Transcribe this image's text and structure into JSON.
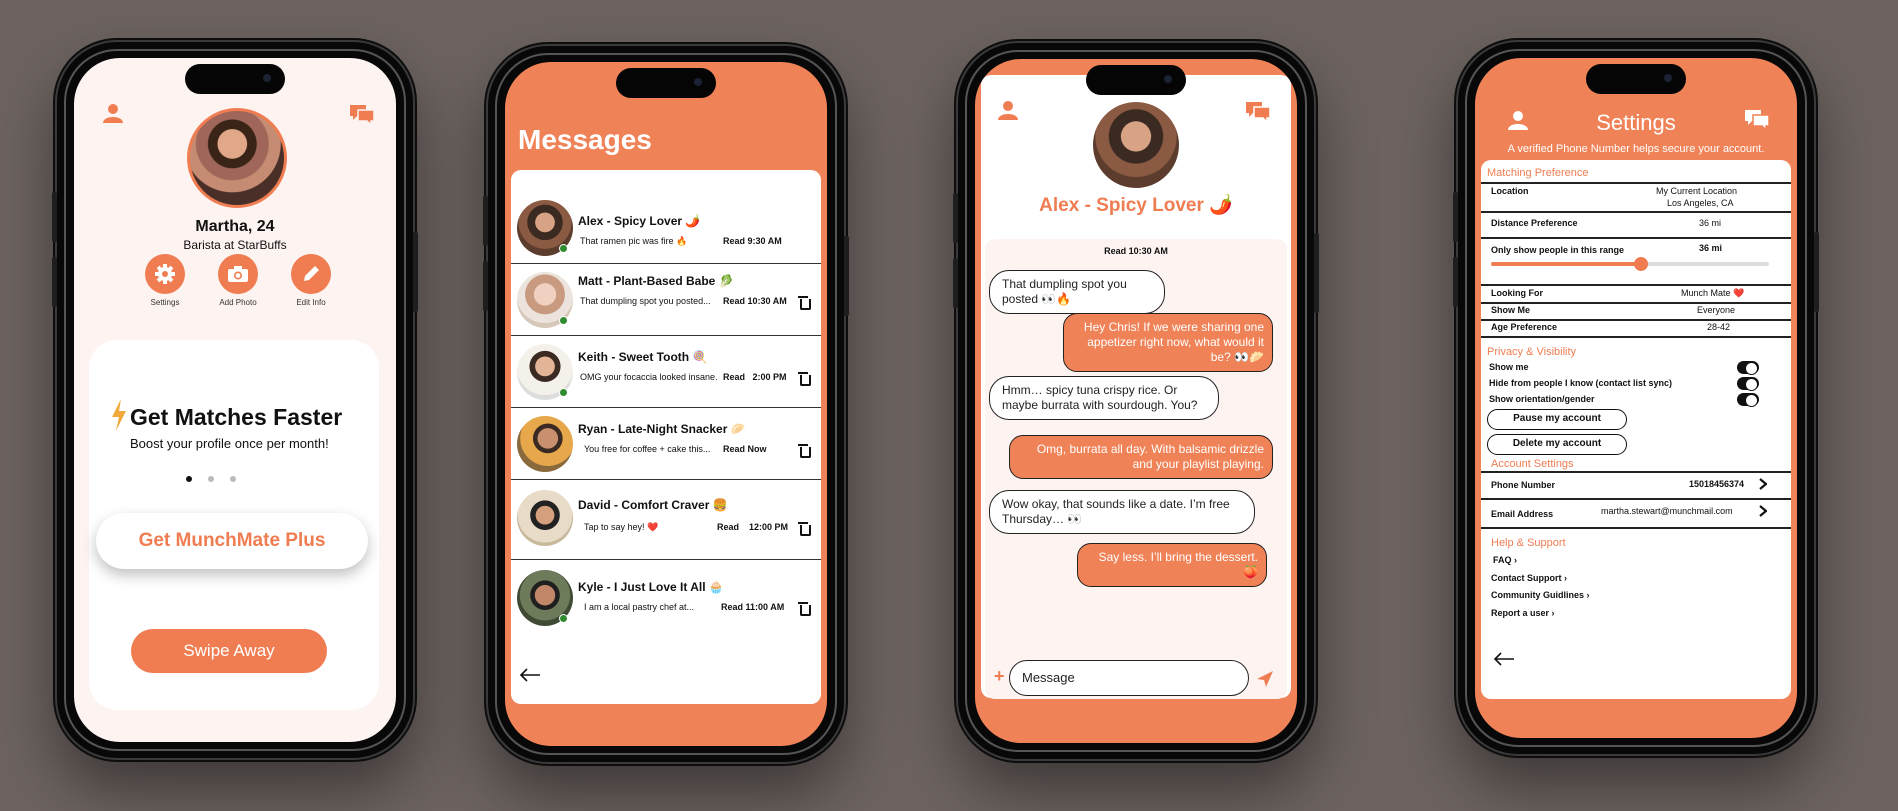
{
  "profile": {
    "name": "Martha, 24",
    "job": "Barista at StarBuffs",
    "actions": [
      {
        "label": "Settings",
        "icon": "gear-icon"
      },
      {
        "label": "Add Photo",
        "icon": "camera-icon"
      },
      {
        "label": "Edit Info",
        "icon": "pencil-icon"
      }
    ],
    "promo_title": "Get Matches Faster",
    "promo_sub": "Boost your profile once per month!",
    "plus_btn": "Get MunchMate Plus",
    "swipe_btn": "Swipe Away"
  },
  "messages": {
    "title": "Messages",
    "items": [
      {
        "name": "Alex - Spicy Lover 🌶️",
        "preview": "That ramen pic was fire 🔥",
        "status": "Read 9:30 AM"
      },
      {
        "name": "Matt - Plant-Based Babe 🥬",
        "preview": "That dumpling spot you posted...",
        "status": "Read 10:30 AM"
      },
      {
        "name": "Keith - Sweet Tooth 🍭",
        "preview": "OMG your focaccia looked insane.",
        "status": "Read   2:00 PM"
      },
      {
        "name": "Ryan - Late-Night Snacker 🥟",
        "preview": "You free for coffee + cake this...",
        "status": "Read Now"
      },
      {
        "name": "David - Comfort Craver 🍔",
        "preview": "Tap to say hey! ❤️",
        "status": "Read    12:00 PM"
      },
      {
        "name": "Kyle - I Just Love It All 🧁",
        "preview": "I am a local pastry chef at...",
        "status": "Read 11:00 AM"
      }
    ]
  },
  "chat": {
    "title": "Alex - Spicy Lover 🌶️",
    "read": "Read 10:30 AM",
    "msgs": [
      {
        "dir": "in",
        "text": "That dumpling spot you posted 👀🔥"
      },
      {
        "dir": "out",
        "text": "Hey Chris! If we were sharing one appetizer right now, what would it be? 👀🥟"
      },
      {
        "dir": "in",
        "text": "Hmm… spicy tuna crispy rice. Or maybe burrata with sourdough. You?"
      },
      {
        "dir": "out",
        "text": "Omg, burrata all day. With balsamic drizzle and your playlist playing."
      },
      {
        "dir": "in",
        "text": "Wow okay, that sounds like a date. I’m free Thursday… 👀"
      },
      {
        "dir": "out",
        "text": "Say less. I’ll bring the dessert. 🍑"
      }
    ],
    "input_placeholder": "Message"
  },
  "settings": {
    "title": "Settings",
    "subtitle": "A verified Phone Number helps secure your account.",
    "matching_header": "Matching Preference",
    "location_label": "Location",
    "location_value1": "My Current Location",
    "location_value2": "Los Angeles, CA",
    "distance_label": "Distance Preference",
    "distance_value": "36 mi",
    "range_label": "Only show people in this range",
    "range_value": "36 mi",
    "range_fraction": 0.54,
    "looking_label": "Looking For",
    "looking_value": "Munch Mate ❤️",
    "showme_label": "Show Me",
    "showme_value": "Everyone",
    "age_label": "Age Preference",
    "age_value": "28-42",
    "privacy_header": "Privacy & Visibility",
    "toggles": [
      "Show me",
      "Hide from people I know (contact list sync)",
      "Show orientation/gender"
    ],
    "pause_btn": "Pause my account",
    "delete_btn": "Delete my account",
    "account_header": "Account Settings",
    "phone_label": "Phone Number",
    "phone_value": "15018456374",
    "email_label": "Email Address",
    "email_value": "martha.stewart@munchmail.com",
    "help_header": "Help & Support",
    "help_links": [
      "FAQ",
      "Contact Support",
      "Community Guidlines",
      "Report a user"
    ]
  },
  "colors": {
    "accent": "#f08257",
    "bg": "#6c6360",
    "light": "#fdf3f1"
  }
}
